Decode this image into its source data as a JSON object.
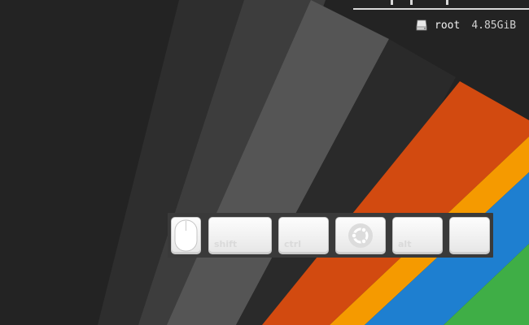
{
  "wallpaper": {
    "colors": {
      "background": "#232323",
      "grey_dark": "#2f2f2f",
      "grey_mid": "#444444",
      "grey_light": "#575757",
      "red": "#d24a10",
      "orange": "#f59a00",
      "blue": "#1e7fd0",
      "green": "#3fae46"
    }
  },
  "conky": {
    "drive_icon": "drive-icon",
    "drive_name": "root",
    "drive_size": "4.85GiB"
  },
  "keys": {
    "mouse_icon": "mouse-icon",
    "shift_label": "shift",
    "ctrl_label": "ctrl",
    "super_icon": "ubuntu-logo-icon",
    "alt_label": "alt"
  }
}
